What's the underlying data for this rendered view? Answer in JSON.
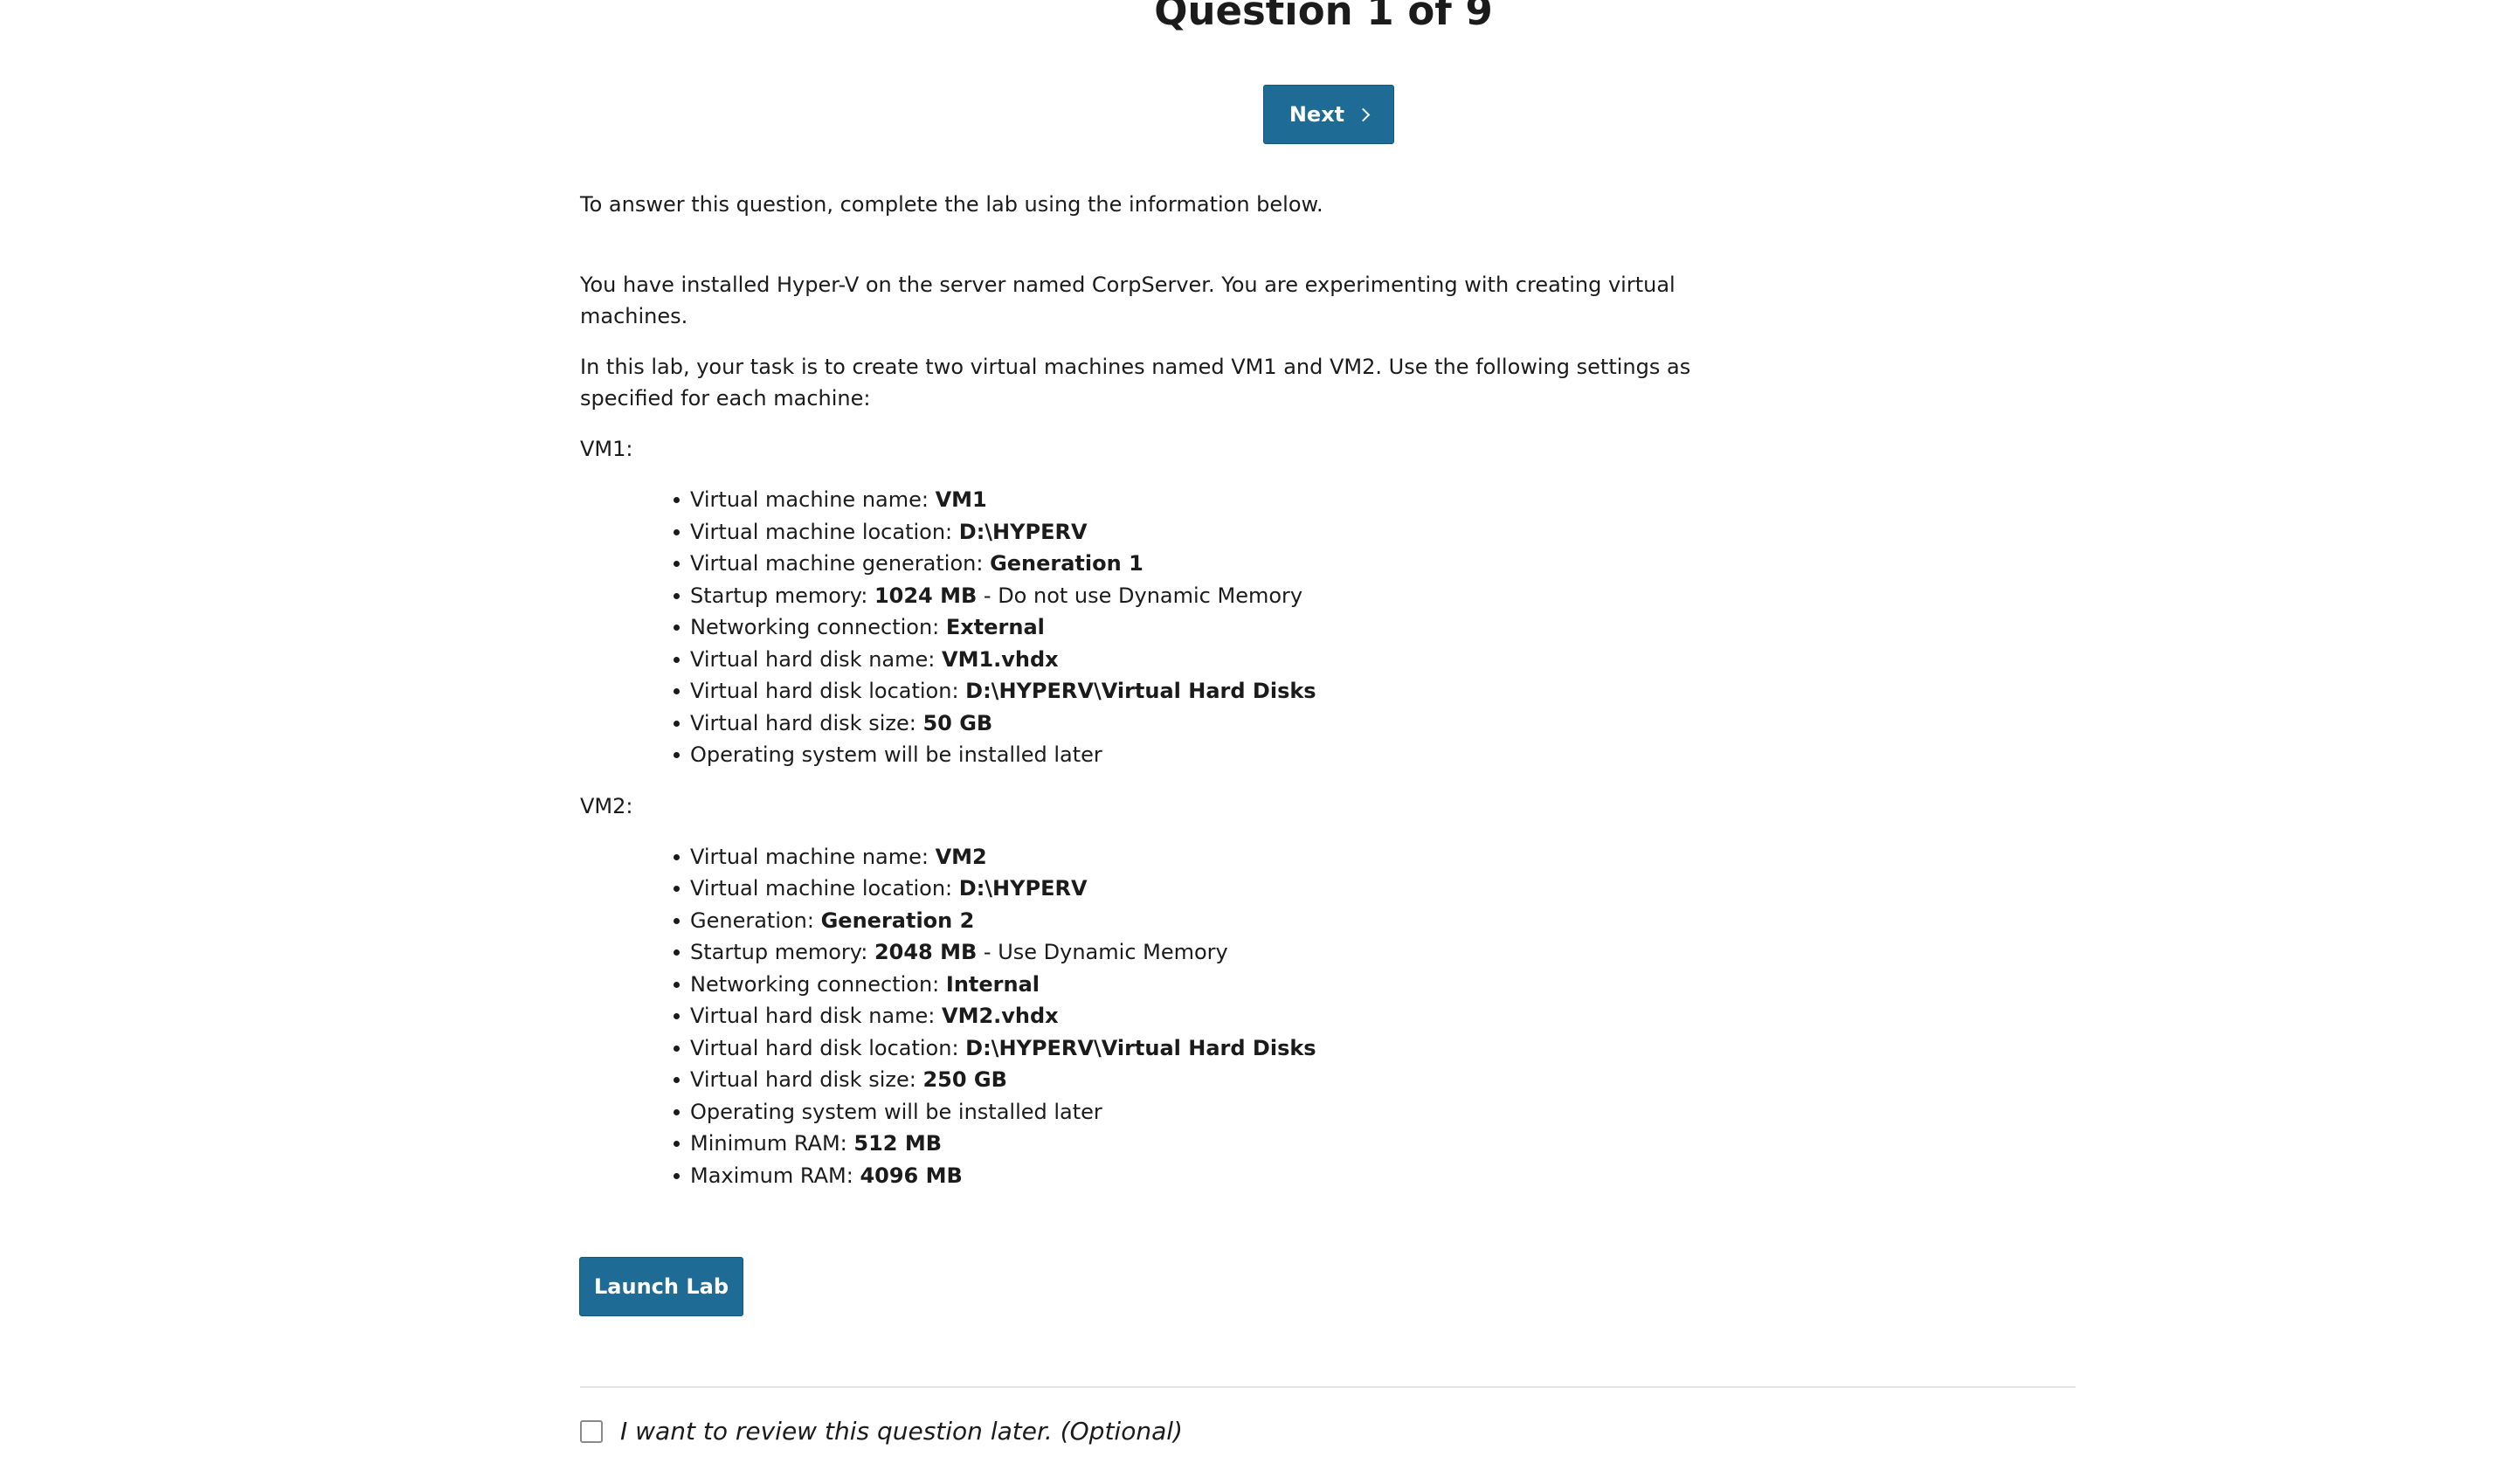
{
  "header": {
    "title": "Question 1 of 9",
    "next_label": "Next"
  },
  "content": {
    "intro": "To answer this question, complete the lab using the information below.",
    "paragraph1": "You have installed Hyper-V on the server named CorpServer. You are experimenting with creating virtual machines.",
    "paragraph2": "In this lab, your task is to create two virtual machines named VM1 and VM2. Use the following settings as specified for each machine:",
    "vm1": {
      "label": "VM1:",
      "items": [
        {
          "label": "Virtual machine name: ",
          "value": "VM1",
          "suffix": ""
        },
        {
          "label": "Virtual machine location: ",
          "value": "D:\\HYPERV",
          "suffix": ""
        },
        {
          "label": "Virtual machine generation: ",
          "value": "Generation 1",
          "suffix": ""
        },
        {
          "label": "Startup memory: ",
          "value": "1024 MB",
          "suffix": " - Do not use Dynamic Memory"
        },
        {
          "label": "Networking connection: ",
          "value": "External",
          "suffix": ""
        },
        {
          "label": "Virtual hard disk name: ",
          "value": "VM1.vhdx",
          "suffix": ""
        },
        {
          "label": "Virtual hard disk location: ",
          "value": "D:\\HYPERV\\Virtual Hard Disks",
          "suffix": ""
        },
        {
          "label": "Virtual hard disk size: ",
          "value": "50 GB",
          "suffix": ""
        },
        {
          "label": "Operating system will be installed later",
          "value": "",
          "suffix": ""
        }
      ]
    },
    "vm2": {
      "label": "VM2:",
      "items": [
        {
          "label": "Virtual machine name: ",
          "value": "VM2",
          "suffix": ""
        },
        {
          "label": "Virtual machine location: ",
          "value": "D:\\HYPERV",
          "suffix": ""
        },
        {
          "label": "Generation: ",
          "value": "Generation 2",
          "suffix": ""
        },
        {
          "label": "Startup memory: ",
          "value": "2048 MB",
          "suffix": " - Use Dynamic Memory"
        },
        {
          "label": "Networking connection: ",
          "value": "Internal",
          "suffix": ""
        },
        {
          "label": "Virtual hard disk name: ",
          "value": "VM2.vhdx",
          "suffix": ""
        },
        {
          "label": "Virtual hard disk location: ",
          "value": "D:\\HYPERV\\Virtual Hard Disks",
          "suffix": ""
        },
        {
          "label": "Virtual hard disk size: ",
          "value": "250 GB",
          "suffix": ""
        },
        {
          "label": "Operating system will be installed later",
          "value": "",
          "suffix": ""
        },
        {
          "label": "Minimum RAM: ",
          "value": "512 MB",
          "suffix": ""
        },
        {
          "label": "Maximum RAM: ",
          "value": "4096 MB",
          "suffix": ""
        }
      ]
    }
  },
  "actions": {
    "launch_label": "Launch Lab"
  },
  "footer": {
    "review_label": "I want to review this question later. (Optional)",
    "review_checked": false
  },
  "colors": {
    "button_bg": "#1e6b96",
    "text": "#1b1b1b",
    "divider": "#e3e3e3"
  }
}
